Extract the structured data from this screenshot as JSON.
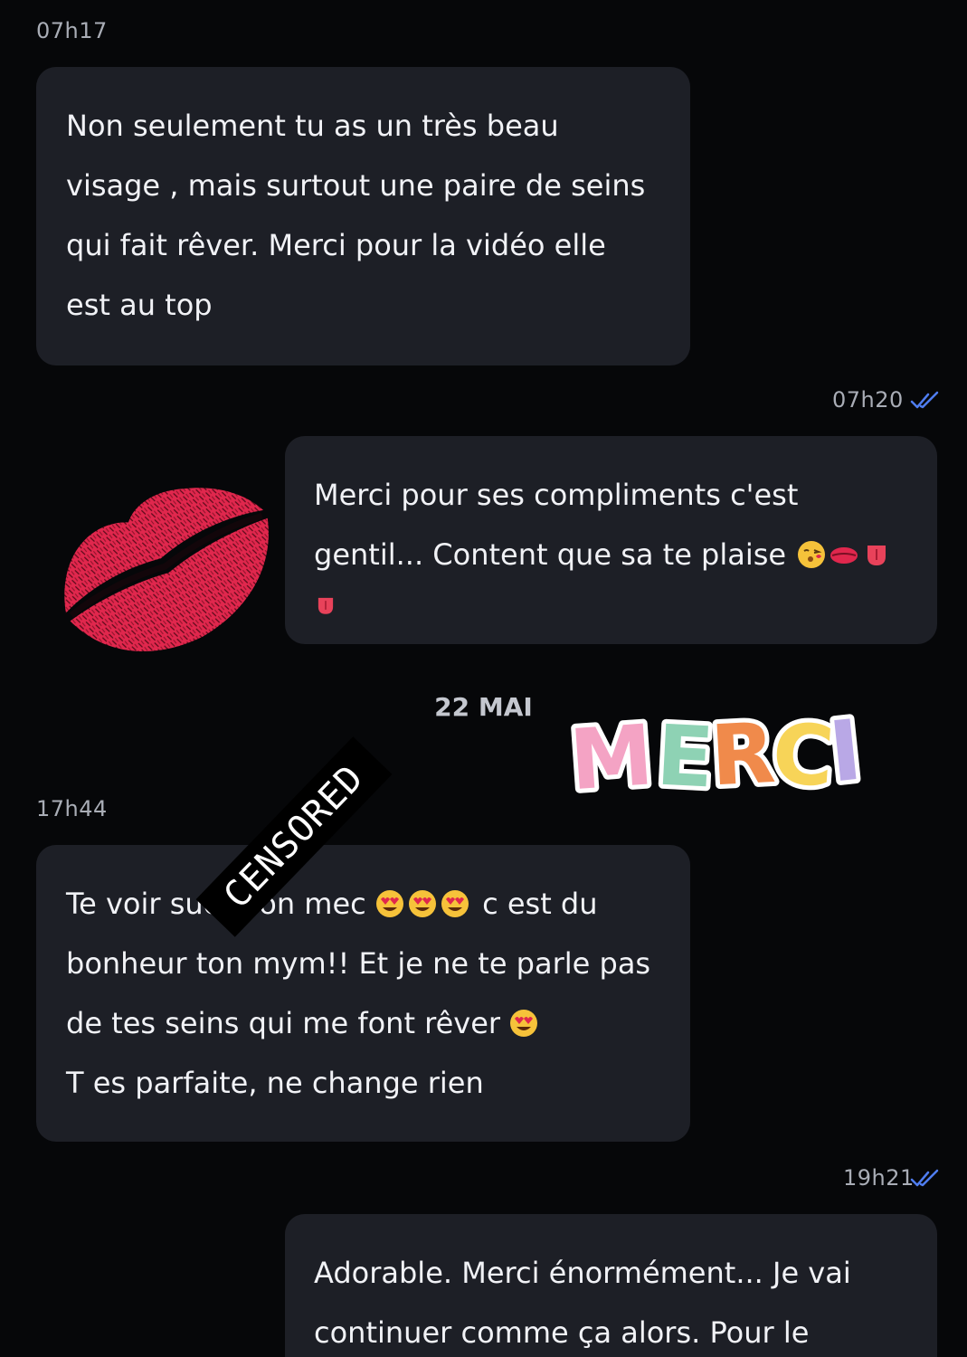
{
  "messages": [
    {
      "time": "07h17",
      "text_lines": [
        "Non seulement tu as un très beau",
        "visage , mais surtout une paire de seins",
        "qui fait rêver. Merci pour la vidéo elle",
        "est au top"
      ]
    },
    {
      "time": "07h20",
      "text_lines": [
        "Merci pour ses compliments c'est",
        "gentil... Content que sa te plaise"
      ]
    },
    {
      "time": "17h44",
      "line1_a": "Te voir suc",
      "line1_b": "on mec",
      "line1_c": "c est du",
      "line2": "bonheur ton mym!! Et je ne te parle pas",
      "line3": "de tes seins qui me font rêver",
      "line4": "T es parfaite, ne change rien"
    },
    {
      "time": "19h21",
      "text_lines": [
        "Adorable. Merci énormément... Je vai",
        "continuer comme ça alors. Pour le"
      ]
    }
  ],
  "date_separator": "22 MAI",
  "stickers": {
    "merci_text": "MERCI",
    "censored_text": "CENSORED",
    "lips_icon": "kiss-lips-icon"
  },
  "colors": {
    "background": "#060709",
    "bubble": "#1d1f26",
    "read_check": "#4f7df0",
    "lips": "#e0274d"
  }
}
